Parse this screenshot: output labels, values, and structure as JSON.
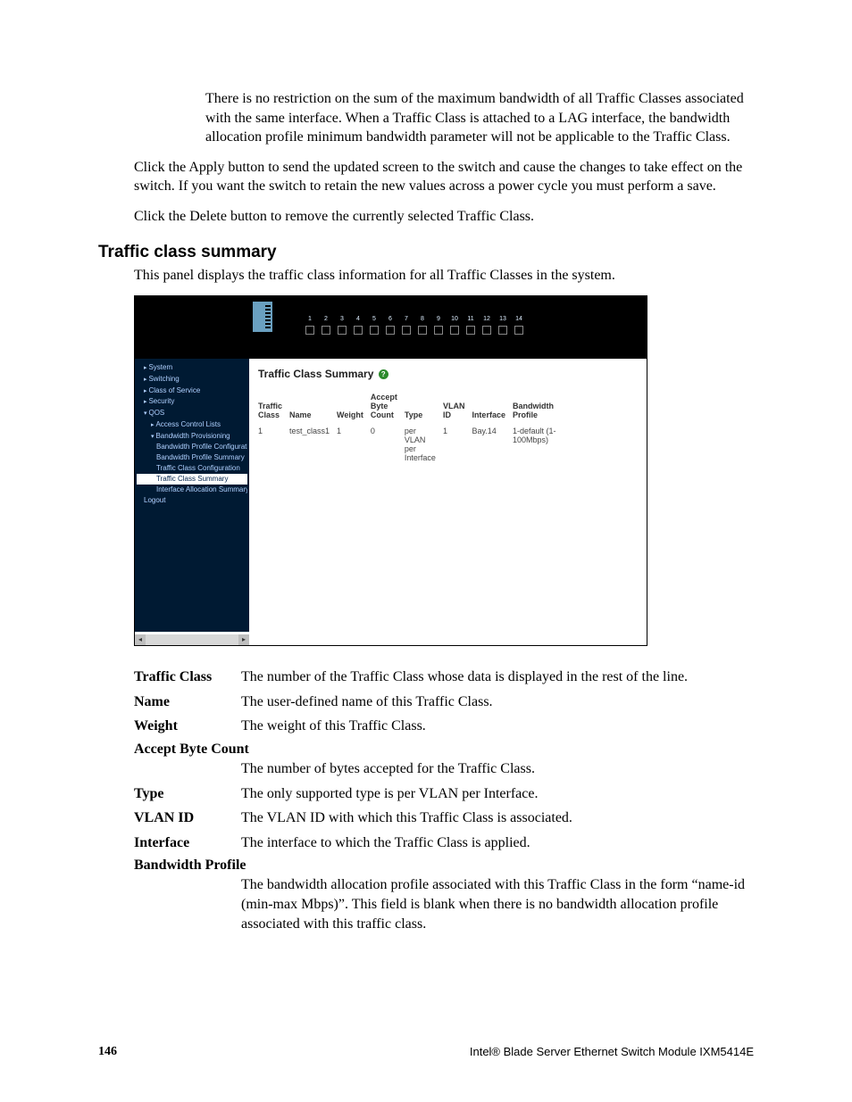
{
  "intro": {
    "p1": "There is no restriction on the sum of the maximum bandwidth of all Traffic Classes associated with the same interface. When a Traffic Class is attached to a LAG interface, the bandwidth allocation profile minimum bandwidth parameter will not be applicable to the Traffic Class.",
    "p2": "Click the Apply button to send the updated screen to the switch and cause the changes to take effect on the switch. If you want the switch to retain the new values across a power cycle you must perform a save.",
    "p3": "Click the Delete button to remove the currently selected Traffic Class."
  },
  "section": {
    "heading": "Traffic class summary",
    "lead": "This panel displays the traffic class information for all Traffic Classes in the system."
  },
  "screenshot": {
    "ports": [
      "1",
      "2",
      "3",
      "4",
      "5",
      "6",
      "7",
      "8",
      "9",
      "10",
      "11",
      "12",
      "13",
      "14"
    ],
    "nav": [
      {
        "label": "System",
        "cls": "cat"
      },
      {
        "label": "Switching",
        "cls": "cat"
      },
      {
        "label": "Class of Service",
        "cls": "cat"
      },
      {
        "label": "Security",
        "cls": "cat"
      },
      {
        "label": "QOS",
        "cls": "open"
      },
      {
        "label": "Access Control Lists",
        "cls": "cat l2"
      },
      {
        "label": "Bandwidth Provisioning",
        "cls": "open l2"
      },
      {
        "label": "Bandwidth Profile Configuration",
        "cls": "l3"
      },
      {
        "label": "Bandwidth Profile Summary",
        "cls": "l3"
      },
      {
        "label": "Traffic Class Configuration",
        "cls": "l3"
      },
      {
        "label": "Traffic Class Summary",
        "cls": "l3 sel"
      },
      {
        "label": "Interface Allocation Summary",
        "cls": "l3"
      },
      {
        "label": "Logout",
        "cls": ""
      }
    ],
    "panel_title": "Traffic Class Summary",
    "help_glyph": "?",
    "table": {
      "headers": [
        "Traffic Class",
        "Name",
        "Weight",
        "Accept Byte Count",
        "Type",
        "VLAN ID",
        "Interface",
        "Bandwidth Profile"
      ],
      "row": [
        "1",
        "test_class1",
        "1",
        "0",
        "per VLAN per Interface",
        "1",
        "Bay.14",
        "1-default (1-100Mbps)"
      ]
    },
    "scroll_left": "◂",
    "scroll_right": "▸"
  },
  "defs": [
    {
      "term": "Traffic Class",
      "desc": "The number of the Traffic Class whose data is displayed in the rest of the line."
    },
    {
      "term": "Name",
      "desc": "The user-defined name of this Traffic Class."
    },
    {
      "term": "Weight",
      "desc": "The weight of this Traffic Class."
    },
    {
      "term": "Accept Byte Count",
      "desc": "The number of bytes accepted for the Traffic Class.",
      "break": true
    },
    {
      "term": "Type",
      "desc": "The only supported type is per VLAN per Interface."
    },
    {
      "term": "VLAN ID",
      "desc": "The VLAN ID with which this Traffic Class is associated."
    },
    {
      "term": "Interface",
      "desc": "The interface to which the Traffic Class is applied."
    },
    {
      "term": "Bandwidth Profile",
      "desc": "The bandwidth allocation profile associated with this Traffic Class in the form “name-id (min-max Mbps)”. This field is blank when there is no bandwidth allocation profile associated with this traffic class.",
      "break": true
    }
  ],
  "footer": {
    "page": "146",
    "product": "Intel® Blade Server Ethernet Switch Module IXM5414E"
  }
}
